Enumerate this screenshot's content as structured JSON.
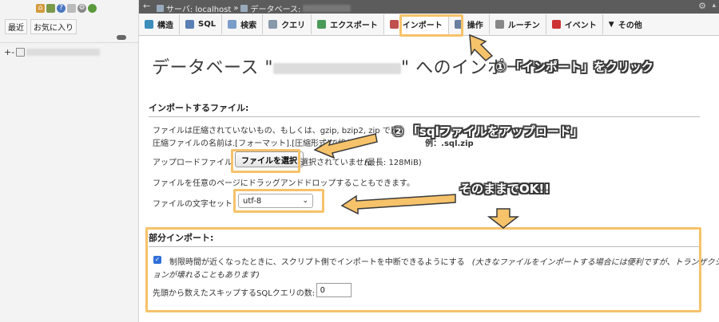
{
  "nav": {
    "tabs": [
      "最近",
      "お気に入り"
    ],
    "tree_sign": "+-"
  },
  "breadcrumb": {
    "server": "サーバ: localhost",
    "sep": "»",
    "database": "データベース:"
  },
  "tabs": [
    {
      "label": "構造",
      "icon": "structure-icon",
      "color": "#3c8dbc"
    },
    {
      "label": "SQL",
      "icon": "sql-icon",
      "color": "#5a7fb5"
    },
    {
      "label": "検索",
      "icon": "search-icon",
      "color": "#7a9cc9"
    },
    {
      "label": "クエリ",
      "icon": "query-icon",
      "color": "#8899aa"
    },
    {
      "label": "エクスポート",
      "icon": "export-icon",
      "color": "#4a9a5a"
    },
    {
      "label": "インポート",
      "icon": "import-icon",
      "color": "#c0504d"
    },
    {
      "label": "操作",
      "icon": "wrench-icon",
      "color": "#6a7fa0"
    },
    {
      "label": "ルーチン",
      "icon": "routine-icon",
      "color": "#888888"
    },
    {
      "label": "イベント",
      "icon": "event-icon",
      "color": "#cc3333"
    },
    {
      "label": "その他",
      "icon": "chevron-down-icon",
      "color": "#444444"
    }
  ],
  "main": {
    "title_prefix": "データベース \"",
    "title_suffix": "\" へのインポート",
    "import_file_heading": "インポートするファイル:",
    "compress_line1": "ファイルは圧縮されていないもの、もしくは、gzip, bzip2, zip で圧",
    "compress_line2": "圧縮ファイルの名前は.[フォーマット].[圧縮形式]で終わ",
    "compress_line2_tail": "例：.sql.zip",
    "upload_label": "アップロードファイル",
    "file_button": "ファイルを選択",
    "file_status": "選択されていません",
    "max_size": "(最長: 128MiB)",
    "drag_drop": "ファイルを任意のページにドラッグアンドドロップすることもできます。",
    "charset_label": "ファイルの文字セット",
    "charset_value": "utf-8",
    "partial_heading": "部分インポート:",
    "timeout_text": "制限時間が近くなったときに、スクリプト側でインポートを中断できるようにする",
    "timeout_note_a": "(大きなファイルをインポートする場合には便利ですが、トランザクシ",
    "timeout_note_b": "ョンが壊れることもあります)",
    "skip_label": "先頭から数えたスキップするSQLクエリの数:",
    "skip_value": "0"
  },
  "annotations": {
    "step1": "① 「インポート」をクリック",
    "step2": "② 「sqlファイルをアップロード」",
    "ok": "そのままでOK!!",
    "highlight_color": "#f6c26a"
  }
}
